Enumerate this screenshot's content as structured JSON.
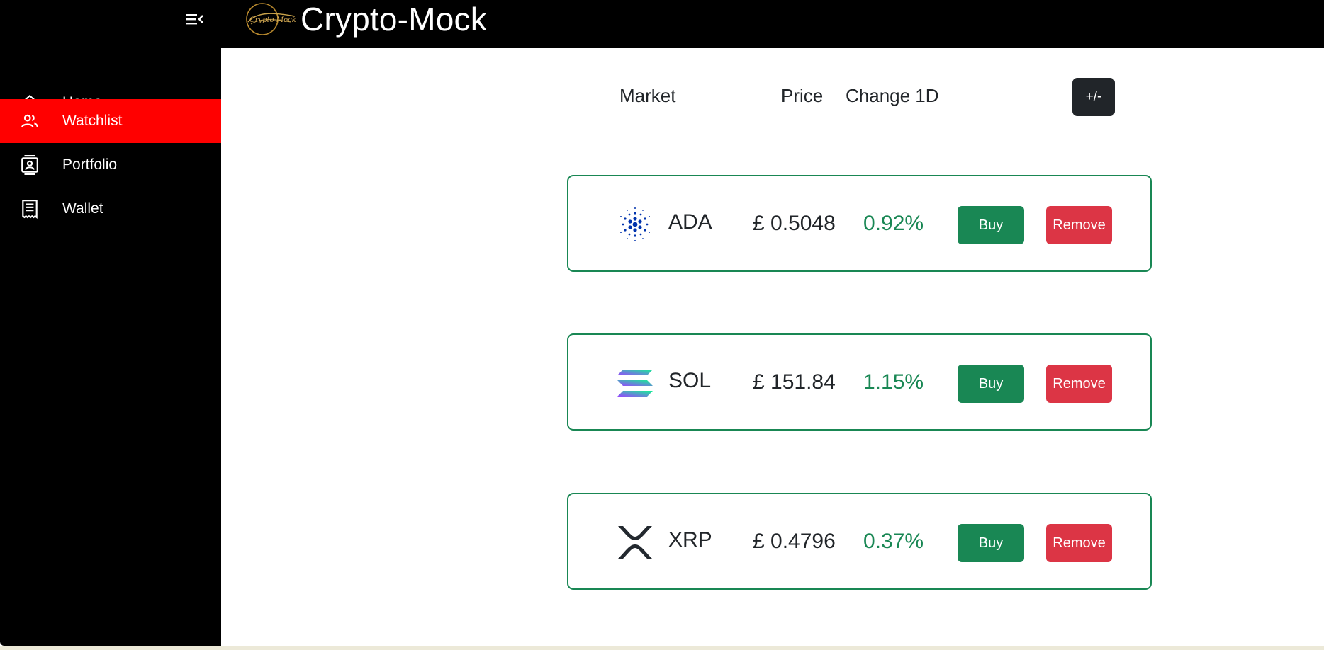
{
  "app": {
    "title": "Crypto-Mock",
    "logo_text": "Crypto-Mock",
    "menu_icon": "menu-collapse-icon"
  },
  "sidebar": {
    "items": [
      {
        "label": "Home",
        "icon": "home-icon",
        "active": false
      },
      {
        "label": "Watchlist",
        "icon": "users-icon",
        "active": true
      },
      {
        "label": "Portfolio",
        "icon": "contact-card-icon",
        "active": false
      },
      {
        "label": "Wallet",
        "icon": "receipt-icon",
        "active": false
      }
    ]
  },
  "watchlist": {
    "headers": {
      "market": "Market",
      "price": "Price",
      "change": "Change 1D"
    },
    "toggle_label": "+/-",
    "rows": [
      {
        "symbol": "ADA",
        "logo": "cardano-logo",
        "price": "£ 0.5048",
        "change": "0.92%",
        "buy_label": "Buy",
        "remove_label": "Remove"
      },
      {
        "symbol": "SOL",
        "logo": "solana-logo",
        "price": "£ 151.84",
        "change": "1.15%",
        "buy_label": "Buy",
        "remove_label": "Remove"
      },
      {
        "symbol": "XRP",
        "logo": "xrp-logo",
        "price": "£ 0.4796",
        "change": "0.37%",
        "buy_label": "Buy",
        "remove_label": "Remove"
      }
    ]
  },
  "colors": {
    "topbar": "#000000",
    "sidebar": "#000000",
    "active_nav": "#ff0000",
    "positive": "#198754",
    "buy": "#198754",
    "remove": "#dc3545",
    "toggle": "#212529"
  }
}
